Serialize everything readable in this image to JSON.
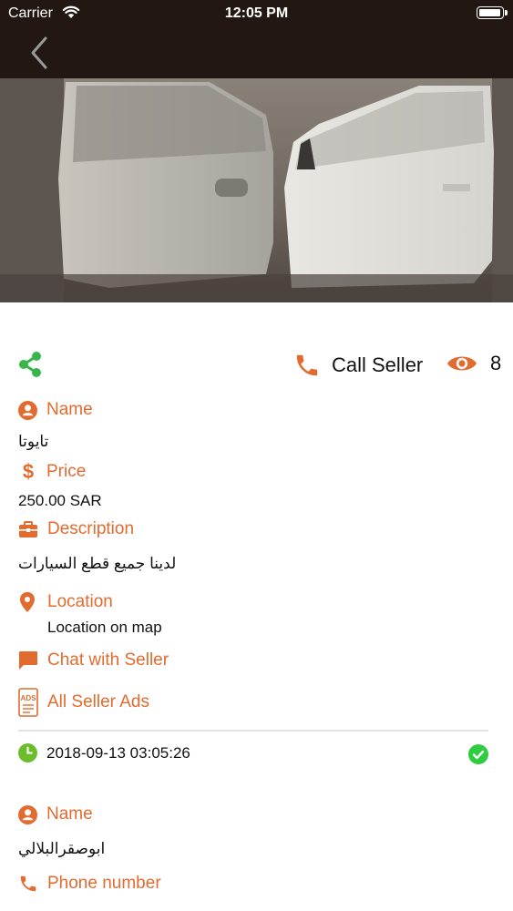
{
  "status_bar": {
    "carrier": "Carrier",
    "time": "12:05 PM",
    "battery_level": 1.0
  },
  "actions": {
    "call_label": "Call Seller",
    "views_count": "8"
  },
  "details": {
    "name_label": "Name",
    "name_value": "تايوتا",
    "price_label": "Price",
    "price_value": "250.00 SAR",
    "description_label": "Description",
    "description_value": "لدينا جميع قطع السيارات",
    "location_label": "Location",
    "location_value": "Location on map",
    "chat_label": "Chat with Seller",
    "all_ads_label": "All Seller Ads",
    "date": "2018-09-13 03:05:26"
  },
  "seller": {
    "name_label": "Name",
    "name_value": "ابوصقرالبلالي",
    "phone_label": "Phone number"
  },
  "colors": {
    "accent": "#e26b2f",
    "header_bg": "#231714",
    "share": "#39b54a",
    "verified": "#2ecc40",
    "clock": "#6cbd2b"
  }
}
